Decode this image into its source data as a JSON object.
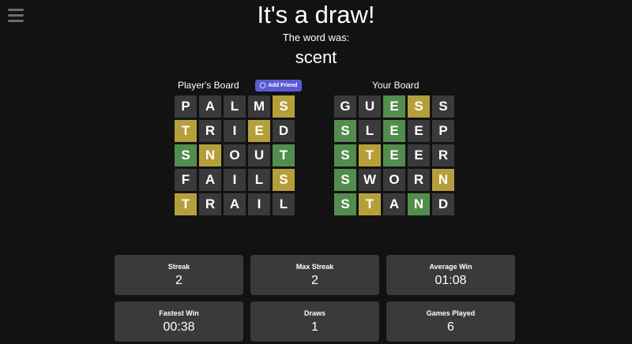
{
  "header": {
    "title": "It's a draw!",
    "subtitle": "The word was:",
    "word": "scent"
  },
  "player_board": {
    "title": "Player's Board",
    "add_friend_label": "Add Friend",
    "rows": [
      [
        [
          "P",
          "d"
        ],
        [
          "A",
          "d"
        ],
        [
          "L",
          "d"
        ],
        [
          "M",
          "d"
        ],
        [
          "S",
          "y"
        ]
      ],
      [
        [
          "T",
          "y"
        ],
        [
          "R",
          "d"
        ],
        [
          "I",
          "d"
        ],
        [
          "E",
          "y"
        ],
        [
          "D",
          "d"
        ]
      ],
      [
        [
          "S",
          "g"
        ],
        [
          "N",
          "y"
        ],
        [
          "O",
          "d"
        ],
        [
          "U",
          "d"
        ],
        [
          "T",
          "g"
        ]
      ],
      [
        [
          "F",
          "d"
        ],
        [
          "A",
          "d"
        ],
        [
          "I",
          "d"
        ],
        [
          "L",
          "d"
        ],
        [
          "S",
          "y"
        ]
      ],
      [
        [
          "T",
          "y"
        ],
        [
          "R",
          "d"
        ],
        [
          "A",
          "d"
        ],
        [
          "I",
          "d"
        ],
        [
          "L",
          "d"
        ]
      ]
    ]
  },
  "your_board": {
    "title": "Your Board",
    "rows": [
      [
        [
          "G",
          "d"
        ],
        [
          "U",
          "d"
        ],
        [
          "E",
          "g"
        ],
        [
          "S",
          "y"
        ],
        [
          "S",
          "d"
        ]
      ],
      [
        [
          "S",
          "g"
        ],
        [
          "L",
          "d"
        ],
        [
          "E",
          "g"
        ],
        [
          "E",
          "d"
        ],
        [
          "P",
          "d"
        ]
      ],
      [
        [
          "S",
          "g"
        ],
        [
          "T",
          "y"
        ],
        [
          "E",
          "g"
        ],
        [
          "E",
          "d"
        ],
        [
          "R",
          "d"
        ]
      ],
      [
        [
          "S",
          "g"
        ],
        [
          "W",
          "d"
        ],
        [
          "O",
          "d"
        ],
        [
          "R",
          "d"
        ],
        [
          "N",
          "y"
        ]
      ],
      [
        [
          "S",
          "g"
        ],
        [
          "T",
          "y"
        ],
        [
          "A",
          "d"
        ],
        [
          "N",
          "g"
        ],
        [
          "D",
          "d"
        ]
      ]
    ]
  },
  "stats": [
    {
      "label": "Streak",
      "value": "2"
    },
    {
      "label": "Max Streak",
      "value": "2"
    },
    {
      "label": "Average Win",
      "value": "01:08"
    },
    {
      "label": "Fastest Win",
      "value": "00:38"
    },
    {
      "label": "Draws",
      "value": "1"
    },
    {
      "label": "Games Played",
      "value": "6"
    }
  ],
  "icons": {
    "menu": "hamburger-menu-icon",
    "add_friend": "user-plus-icon"
  },
  "colors": {
    "correct": "#538d4e",
    "present": "#b59f3b",
    "absent": "#3a3a3c",
    "accent": "#5b5bd6"
  }
}
